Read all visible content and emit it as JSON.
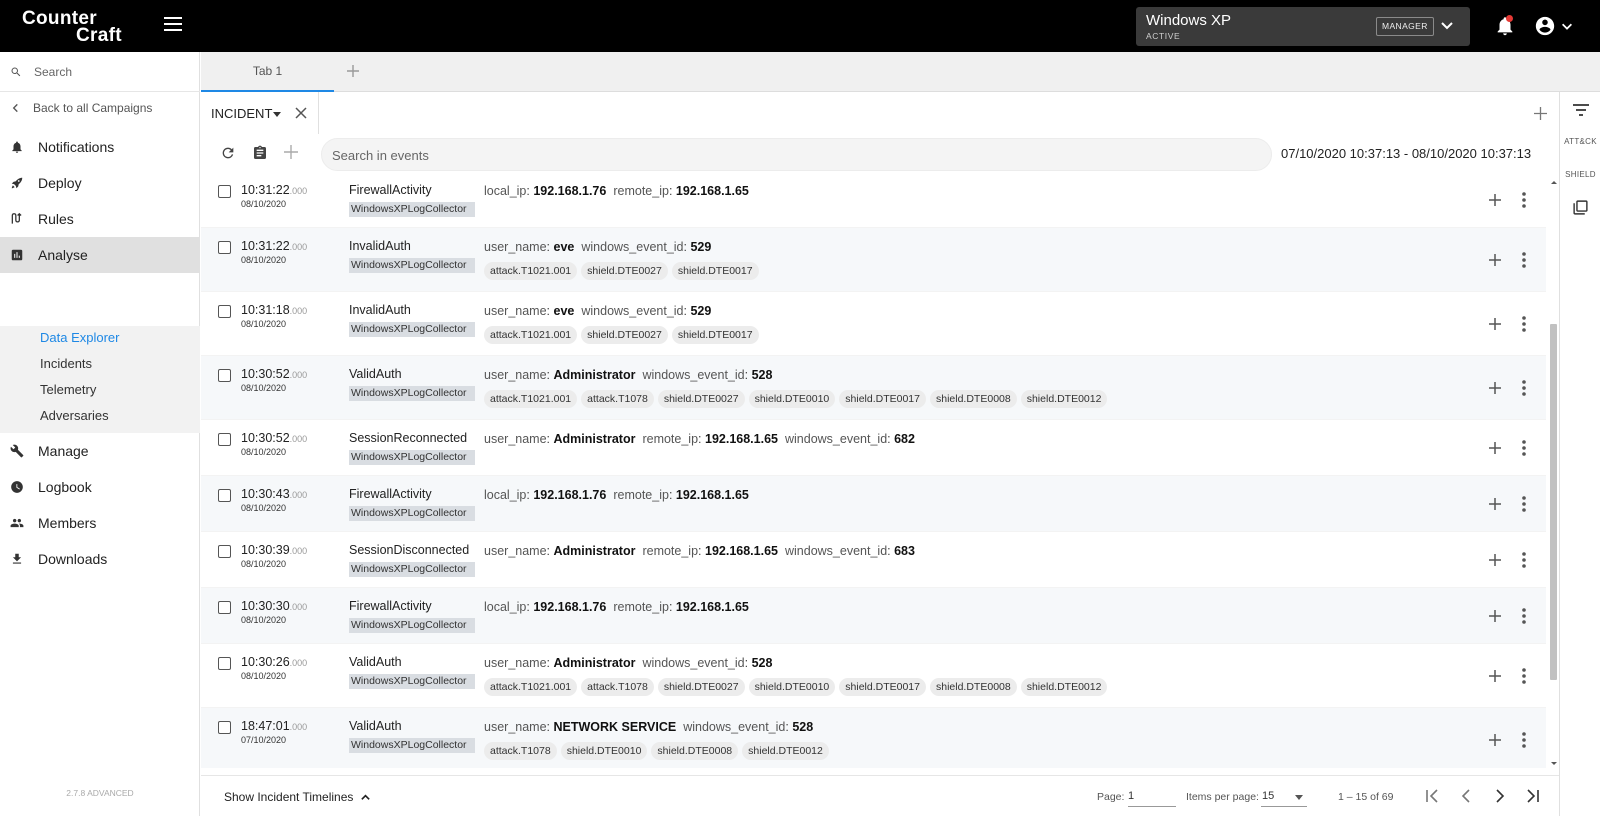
{
  "brand": {
    "line1": "Counter",
    "line2": "Craft"
  },
  "campaign": {
    "name": "Windows XP",
    "status": "ACTIVE",
    "role": "MANAGER"
  },
  "sidebar": {
    "search_placeholder": "Search",
    "back_label": "Back to all Campaigns",
    "items": [
      {
        "label": "Notifications",
        "icon": "bell-icon"
      },
      {
        "label": "Deploy",
        "icon": "rocket-icon"
      },
      {
        "label": "Rules",
        "icon": "rules-icon"
      },
      {
        "label": "Analyse",
        "icon": "chart-icon",
        "active": true
      },
      {
        "label": "Manage",
        "icon": "wrench-icon"
      },
      {
        "label": "Logbook",
        "icon": "clock-icon"
      },
      {
        "label": "Members",
        "icon": "people-icon"
      },
      {
        "label": "Downloads",
        "icon": "download-icon"
      }
    ],
    "subitems": [
      {
        "label": "Data Explorer",
        "selected": true
      },
      {
        "label": "Incidents"
      },
      {
        "label": "Telemetry"
      },
      {
        "label": "Adversaries"
      }
    ],
    "version": "2.7.8 ADVANCED"
  },
  "tabs": {
    "tab1": "Tab 1"
  },
  "incident": {
    "name": "INCIDENT"
  },
  "toolbar": {
    "search_placeholder": "Search in events",
    "date_range": "07/10/2020 10:37:13 - 08/10/2020 10:37:13"
  },
  "events": [
    {
      "time": "10:31:22",
      "ms": ".000",
      "date": "08/10/2020",
      "type": "FirewallActivity",
      "source": "WindowsXPLogCollector",
      "fields": [
        {
          "k": "local_ip",
          "v": "192.168.1.76"
        },
        {
          "k": "remote_ip",
          "v": "192.168.1.65"
        }
      ],
      "tags": []
    },
    {
      "time": "10:31:22",
      "ms": ".000",
      "date": "08/10/2020",
      "type": "InvalidAuth",
      "source": "WindowsXPLogCollector",
      "fields": [
        {
          "k": "user_name",
          "v": "eve"
        },
        {
          "k": "windows_event_id",
          "v": "529"
        }
      ],
      "tags": [
        "attack.T1021.001",
        "shield.DTE0027",
        "shield.DTE0017"
      ]
    },
    {
      "time": "10:31:18",
      "ms": ".000",
      "date": "08/10/2020",
      "type": "InvalidAuth",
      "source": "WindowsXPLogCollector",
      "fields": [
        {
          "k": "user_name",
          "v": "eve"
        },
        {
          "k": "windows_event_id",
          "v": "529"
        }
      ],
      "tags": [
        "attack.T1021.001",
        "shield.DTE0027",
        "shield.DTE0017"
      ]
    },
    {
      "time": "10:30:52",
      "ms": ".000",
      "date": "08/10/2020",
      "type": "ValidAuth",
      "source": "WindowsXPLogCollector",
      "fields": [
        {
          "k": "user_name",
          "v": "Administrator"
        },
        {
          "k": "windows_event_id",
          "v": "528"
        }
      ],
      "tags": [
        "attack.T1021.001",
        "attack.T1078",
        "shield.DTE0027",
        "shield.DTE0010",
        "shield.DTE0017",
        "shield.DTE0008",
        "shield.DTE0012"
      ]
    },
    {
      "time": "10:30:52",
      "ms": ".000",
      "date": "08/10/2020",
      "type": "SessionReconnected",
      "source": "WindowsXPLogCollector",
      "fields": [
        {
          "k": "user_name",
          "v": "Administrator"
        },
        {
          "k": "remote_ip",
          "v": "192.168.1.65"
        },
        {
          "k": "windows_event_id",
          "v": "682"
        }
      ],
      "tags": []
    },
    {
      "time": "10:30:43",
      "ms": ".000",
      "date": "08/10/2020",
      "type": "FirewallActivity",
      "source": "WindowsXPLogCollector",
      "fields": [
        {
          "k": "local_ip",
          "v": "192.168.1.76"
        },
        {
          "k": "remote_ip",
          "v": "192.168.1.65"
        }
      ],
      "tags": []
    },
    {
      "time": "10:30:39",
      "ms": ".000",
      "date": "08/10/2020",
      "type": "SessionDisconnected",
      "source": "WindowsXPLogCollector",
      "fields": [
        {
          "k": "user_name",
          "v": "Administrator"
        },
        {
          "k": "remote_ip",
          "v": "192.168.1.65"
        },
        {
          "k": "windows_event_id",
          "v": "683"
        }
      ],
      "tags": []
    },
    {
      "time": "10:30:30",
      "ms": ".000",
      "date": "08/10/2020",
      "type": "FirewallActivity",
      "source": "WindowsXPLogCollector",
      "fields": [
        {
          "k": "local_ip",
          "v": "192.168.1.76"
        },
        {
          "k": "remote_ip",
          "v": "192.168.1.65"
        }
      ],
      "tags": []
    },
    {
      "time": "10:30:26",
      "ms": ".000",
      "date": "08/10/2020",
      "type": "ValidAuth",
      "source": "WindowsXPLogCollector",
      "fields": [
        {
          "k": "user_name",
          "v": "Administrator"
        },
        {
          "k": "windows_event_id",
          "v": "528"
        }
      ],
      "tags": [
        "attack.T1021.001",
        "attack.T1078",
        "shield.DTE0027",
        "shield.DTE0010",
        "shield.DTE0017",
        "shield.DTE0008",
        "shield.DTE0012"
      ]
    },
    {
      "time": "18:47:01",
      "ms": ".000",
      "date": "07/10/2020",
      "type": "ValidAuth",
      "source": "WindowsXPLogCollector",
      "fields": [
        {
          "k": "user_name",
          "v": "NETWORK SERVICE"
        },
        {
          "k": "windows_event_id",
          "v": "528"
        }
      ],
      "tags": [
        "attack.T1078",
        "shield.DTE0010",
        "shield.DTE0008",
        "shield.DTE0012"
      ]
    }
  ],
  "footer": {
    "timelines_label": "Show Incident Timelines",
    "page_label": "Page:",
    "page_value": "1",
    "items_per_page_label": "Items per page:",
    "items_per_page_value": "15",
    "range": "1 – 15 of 69"
  },
  "rail": {
    "attack_label": "ATT&CK",
    "shield_label": "SHIELD"
  },
  "colors": {
    "accent": "#1e88e5",
    "topbar": "#000000",
    "row_alt": "#f6f8fa",
    "notification_dot": "#e53935"
  }
}
